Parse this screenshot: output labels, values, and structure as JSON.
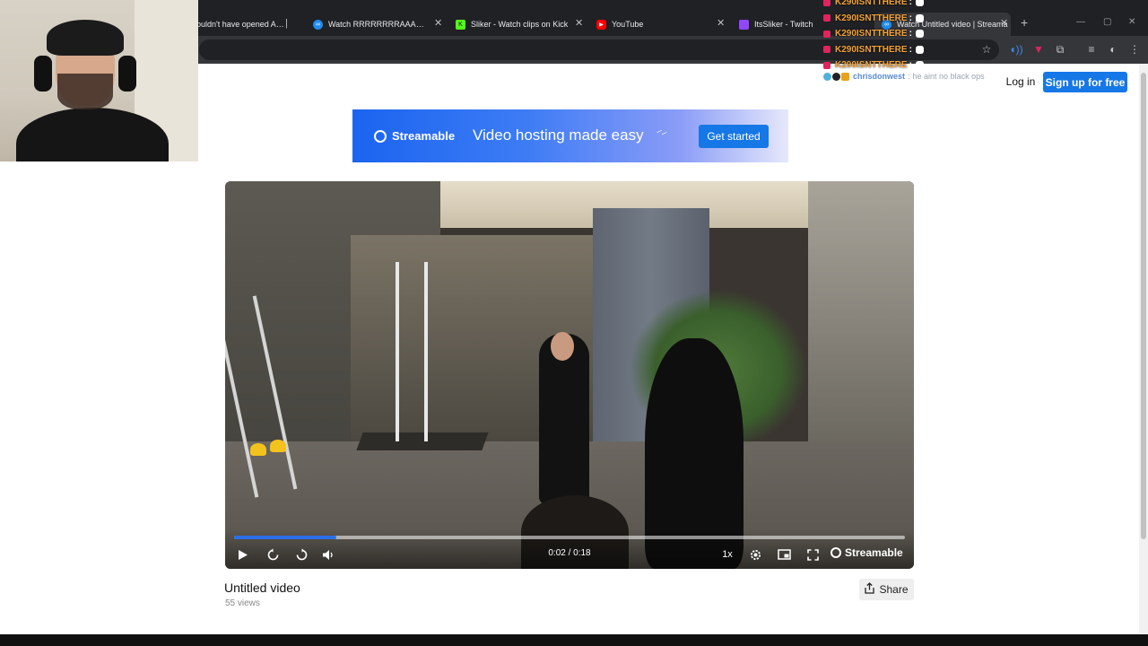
{
  "browser": {
    "tabs": [
      {
        "title": "ouldn't have opened AZAR",
        "favicon_color": "#202124"
      },
      {
        "title": "Watch RRRRRRRRAAAAAAAAT",
        "favicon_color": "#1e8bf0"
      },
      {
        "title": "Sliker - Watch clips on Kick",
        "favicon_color": "#53fc18"
      },
      {
        "title": "YouTube",
        "favicon_color": "#ff0000"
      },
      {
        "title": "ItsSliker - Twitch",
        "favicon_color": "#9146ff"
      },
      {
        "title": "Watch Untitled video | Streama",
        "favicon_color": "#1e8bf0"
      }
    ],
    "new_tab_label": "+"
  },
  "chat": {
    "repeat_user": "K290ISNTTHERE",
    "repeat_lines": 5,
    "top_partial": "K290ISNTTHERE",
    "user2": "chrisdonwest",
    "message2": "he aint no black ops"
  },
  "header": {
    "login_label": "Log in",
    "signup_label": "Sign up for free"
  },
  "banner": {
    "brand": "Streamable",
    "tagline": "Video hosting made easy",
    "cta": "Get started"
  },
  "player": {
    "time": "0:02 / 0:18",
    "progress": 0.152,
    "speed": "1x",
    "brand": "Streamable"
  },
  "video": {
    "title": "Untitled video",
    "views": "55 views",
    "share_label": "Share"
  }
}
